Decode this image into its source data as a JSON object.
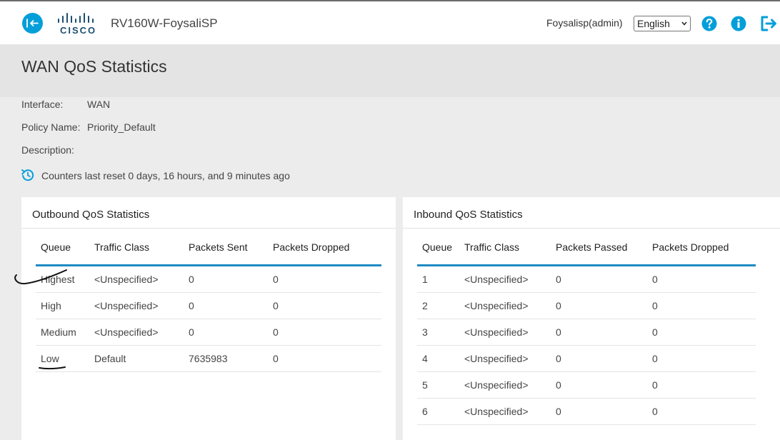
{
  "header": {
    "device_name": "RV160W-FoysaliSP",
    "user": "Foysalisp(admin)",
    "language": "English",
    "logo_text": "CISCO"
  },
  "page_title": "WAN QoS Statistics",
  "info": {
    "interface_label": "Interface:",
    "interface_value": "WAN",
    "policy_label": "Policy Name:",
    "policy_value": "Priority_Default",
    "description_label": "Description:",
    "counters_text": "Counters last reset 0 days, 16 hours, and 9 minutes ago"
  },
  "outbound": {
    "title": "Outbound QoS Statistics",
    "columns": [
      "Queue",
      "Traffic Class",
      "Packets Sent",
      "Packets Dropped"
    ],
    "rows": [
      [
        "Highest",
        "<Unspecified>",
        "0",
        "0"
      ],
      [
        "High",
        "<Unspecified>",
        "0",
        "0"
      ],
      [
        "Medium",
        "<Unspecified>",
        "0",
        "0"
      ],
      [
        "Low",
        "Default",
        "7635983",
        "0"
      ]
    ]
  },
  "inbound": {
    "title": "Inbound QoS Statistics",
    "columns": [
      "Queue",
      "Traffic Class",
      "Packets Passed",
      "Packets Dropped"
    ],
    "rows": [
      [
        "1",
        "<Unspecified>",
        "0",
        "0"
      ],
      [
        "2",
        "<Unspecified>",
        "0",
        "0"
      ],
      [
        "3",
        "<Unspecified>",
        "0",
        "0"
      ],
      [
        "4",
        "<Unspecified>",
        "0",
        "0"
      ],
      [
        "5",
        "<Unspecified>",
        "0",
        "0"
      ],
      [
        "6",
        "<Unspecified>",
        "0",
        "0"
      ]
    ]
  },
  "colors": {
    "accent": "#049fd9",
    "table_header_rule": "#1e8bc3",
    "title_band": "#e4e4e4",
    "page_bg": "#ececec"
  },
  "icons": [
    "menu-toggle-icon",
    "cisco-logo",
    "help-icon",
    "info-icon",
    "logout-icon",
    "counter-reset-icon"
  ]
}
